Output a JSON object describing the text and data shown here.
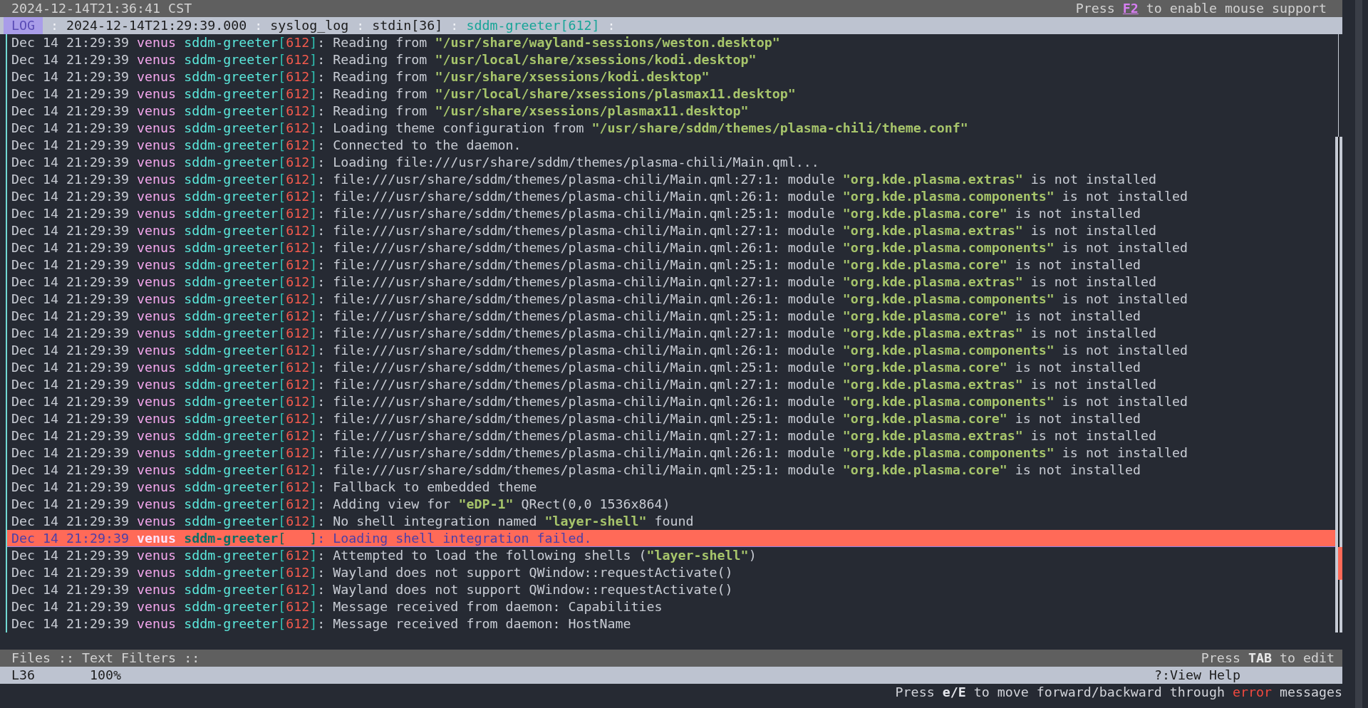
{
  "clock_bar": {
    "time": "2024-12-14T21:36:41 CST",
    "hint": [
      {
        "text": "Press "
      },
      {
        "text": "F2",
        "kind": "key"
      },
      {
        "text": " to enable mouse support"
      }
    ]
  },
  "breadcrumb_bar": {
    "view": "LOG",
    "crumbs": [
      {
        "separator": ":",
        "text": "2024-12-14T21:29:39.000",
        "selected": false
      },
      {
        "separator": ":",
        "text": "syslog_log",
        "selected": false
      },
      {
        "separator": ":",
        "text": "stdin[36]",
        "selected": false
      },
      {
        "separator": ":",
        "text": "sddm-greeter[612]",
        "selected": true
      }
    ],
    "trailing_separator": ":"
  },
  "log_lines": [
    {
      "time": "Dec 14 21:29:39",
      "host": "venus",
      "process": "sddm-greeter[612]:",
      "error": false,
      "message": "Reading from **\"/usr/share/wayland-sessions/weston.desktop\"**"
    },
    {
      "time": "Dec 14 21:29:39",
      "host": "venus",
      "process": "sddm-greeter[612]:",
      "error": false,
      "message": "Reading from **\"/usr/local/share/xsessions/kodi.desktop\"**"
    },
    {
      "time": "Dec 14 21:29:39",
      "host": "venus",
      "process": "sddm-greeter[612]:",
      "error": false,
      "message": "Reading from **\"/usr/share/xsessions/kodi.desktop\"**"
    },
    {
      "time": "Dec 14 21:29:39",
      "host": "venus",
      "process": "sddm-greeter[612]:",
      "error": false,
      "message": "Reading from **\"/usr/local/share/xsessions/plasmax11.desktop\"**"
    },
    {
      "time": "Dec 14 21:29:39",
      "host": "venus",
      "process": "sddm-greeter[612]:",
      "error": false,
      "message": "Reading from **\"/usr/share/xsessions/plasmax11.desktop\"**"
    },
    {
      "time": "Dec 14 21:29:39",
      "host": "venus",
      "process": "sddm-greeter[612]:",
      "error": false,
      "message": "Loading theme configuration from **\"/usr/share/sddm/themes/plasma-chili/theme.conf\"**"
    },
    {
      "time": "Dec 14 21:29:39",
      "host": "venus",
      "process": "sddm-greeter[612]:",
      "error": false,
      "message": "Connected to the daemon."
    },
    {
      "time": "Dec 14 21:29:39",
      "host": "venus",
      "process": "sddm-greeter[612]:",
      "error": false,
      "message": "Loading file:///usr/share/sddm/themes/plasma-chili/Main.qml..."
    },
    {
      "time": "Dec 14 21:29:39",
      "host": "venus",
      "process": "sddm-greeter[612]:",
      "error": false,
      "message": "file:///usr/share/sddm/themes/plasma-chili/Main.qml:27:1: module **\"org.kde.plasma.extras\"** is not installed"
    },
    {
      "time": "Dec 14 21:29:39",
      "host": "venus",
      "process": "sddm-greeter[612]:",
      "error": false,
      "message": "file:///usr/share/sddm/themes/plasma-chili/Main.qml:26:1: module **\"org.kde.plasma.components\"** is not installed"
    },
    {
      "time": "Dec 14 21:29:39",
      "host": "venus",
      "process": "sddm-greeter[612]:",
      "error": false,
      "message": "file:///usr/share/sddm/themes/plasma-chili/Main.qml:25:1: module **\"org.kde.plasma.core\"** is not installed"
    },
    {
      "time": "Dec 14 21:29:39",
      "host": "venus",
      "process": "sddm-greeter[612]:",
      "error": false,
      "message": "file:///usr/share/sddm/themes/plasma-chili/Main.qml:27:1: module **\"org.kde.plasma.extras\"** is not installed"
    },
    {
      "time": "Dec 14 21:29:39",
      "host": "venus",
      "process": "sddm-greeter[612]:",
      "error": false,
      "message": "file:///usr/share/sddm/themes/plasma-chili/Main.qml:26:1: module **\"org.kde.plasma.components\"** is not installed"
    },
    {
      "time": "Dec 14 21:29:39",
      "host": "venus",
      "process": "sddm-greeter[612]:",
      "error": false,
      "message": "file:///usr/share/sddm/themes/plasma-chili/Main.qml:25:1: module **\"org.kde.plasma.core\"** is not installed"
    },
    {
      "time": "Dec 14 21:29:39",
      "host": "venus",
      "process": "sddm-greeter[612]:",
      "error": false,
      "message": "file:///usr/share/sddm/themes/plasma-chili/Main.qml:27:1: module **\"org.kde.plasma.extras\"** is not installed"
    },
    {
      "time": "Dec 14 21:29:39",
      "host": "venus",
      "process": "sddm-greeter[612]:",
      "error": false,
      "message": "file:///usr/share/sddm/themes/plasma-chili/Main.qml:26:1: module **\"org.kde.plasma.components\"** is not installed"
    },
    {
      "time": "Dec 14 21:29:39",
      "host": "venus",
      "process": "sddm-greeter[612]:",
      "error": false,
      "message": "file:///usr/share/sddm/themes/plasma-chili/Main.qml:25:1: module **\"org.kde.plasma.core\"** is not installed"
    },
    {
      "time": "Dec 14 21:29:39",
      "host": "venus",
      "process": "sddm-greeter[612]:",
      "error": false,
      "message": "file:///usr/share/sddm/themes/plasma-chili/Main.qml:27:1: module **\"org.kde.plasma.extras\"** is not installed"
    },
    {
      "time": "Dec 14 21:29:39",
      "host": "venus",
      "process": "sddm-greeter[612]:",
      "error": false,
      "message": "file:///usr/share/sddm/themes/plasma-chili/Main.qml:26:1: module **\"org.kde.plasma.components\"** is not installed"
    },
    {
      "time": "Dec 14 21:29:39",
      "host": "venus",
      "process": "sddm-greeter[612]:",
      "error": false,
      "message": "file:///usr/share/sddm/themes/plasma-chili/Main.qml:25:1: module **\"org.kde.plasma.core\"** is not installed"
    },
    {
      "time": "Dec 14 21:29:39",
      "host": "venus",
      "process": "sddm-greeter[612]:",
      "error": false,
      "message": "file:///usr/share/sddm/themes/plasma-chili/Main.qml:27:1: module **\"org.kde.plasma.extras\"** is not installed"
    },
    {
      "time": "Dec 14 21:29:39",
      "host": "venus",
      "process": "sddm-greeter[612]:",
      "error": false,
      "message": "file:///usr/share/sddm/themes/plasma-chili/Main.qml:26:1: module **\"org.kde.plasma.components\"** is not installed"
    },
    {
      "time": "Dec 14 21:29:39",
      "host": "venus",
      "process": "sddm-greeter[612]:",
      "error": false,
      "message": "file:///usr/share/sddm/themes/plasma-chili/Main.qml:25:1: module **\"org.kde.plasma.core\"** is not installed"
    },
    {
      "time": "Dec 14 21:29:39",
      "host": "venus",
      "process": "sddm-greeter[612]:",
      "error": false,
      "message": "file:///usr/share/sddm/themes/plasma-chili/Main.qml:27:1: module **\"org.kde.plasma.extras\"** is not installed"
    },
    {
      "time": "Dec 14 21:29:39",
      "host": "venus",
      "process": "sddm-greeter[612]:",
      "error": false,
      "message": "file:///usr/share/sddm/themes/plasma-chili/Main.qml:26:1: module **\"org.kde.plasma.components\"** is not installed"
    },
    {
      "time": "Dec 14 21:29:39",
      "host": "venus",
      "process": "sddm-greeter[612]:",
      "error": false,
      "message": "file:///usr/share/sddm/themes/plasma-chili/Main.qml:25:1: module **\"org.kde.plasma.core\"** is not installed"
    },
    {
      "time": "Dec 14 21:29:39",
      "host": "venus",
      "process": "sddm-greeter[612]:",
      "error": false,
      "message": "Fallback to embedded theme"
    },
    {
      "time": "Dec 14 21:29:39",
      "host": "venus",
      "process": "sddm-greeter[612]:",
      "error": false,
      "message": "Adding view for **\"eDP-1\"** QRect(0,0 1536x864)"
    },
    {
      "time": "Dec 14 21:29:39",
      "host": "venus",
      "process": "sddm-greeter[612]:",
      "error": false,
      "message": "No shell integration named **\"layer-shell\"** found"
    },
    {
      "time": "Dec 14 21:29:39",
      "host": "venus",
      "process": "sddm-greeter[   ]:",
      "error": true,
      "message": "Loading shell integration failed."
    },
    {
      "time": "Dec 14 21:29:39",
      "host": "venus",
      "process": "sddm-greeter[612]:",
      "error": false,
      "message": "Attempted to load the following shells (**\"layer-shell\"**)"
    },
    {
      "time": "Dec 14 21:29:39",
      "host": "venus",
      "process": "sddm-greeter[612]:",
      "error": false,
      "message": "Wayland does not support QWindow::requestActivate()"
    },
    {
      "time": "Dec 14 21:29:39",
      "host": "venus",
      "process": "sddm-greeter[612]:",
      "error": false,
      "message": "Wayland does not support QWindow::requestActivate()"
    },
    {
      "time": "Dec 14 21:29:39",
      "host": "venus",
      "process": "sddm-greeter[612]:",
      "error": false,
      "message": "Message received from daemon: Capabilities"
    },
    {
      "time": "Dec 14 21:29:39",
      "host": "venus",
      "process": "sddm-greeter[612]:",
      "error": false,
      "message": "Message received from daemon: HostName"
    }
  ],
  "panel_bar": {
    "title": "Files :: Text Filters ::",
    "hint": [
      {
        "text": "Press "
      },
      {
        "text": "TAB",
        "kind": "key"
      },
      {
        "text": " to edit"
      }
    ]
  },
  "status_bar": {
    "line": "L36",
    "percent": "100%",
    "help": "?:View Help"
  },
  "help_line": [
    {
      "text": "Press "
    },
    {
      "text": "e/E",
      "kind": "key"
    },
    {
      "text": " to move forward/backward through "
    },
    {
      "text": "error",
      "kind": "error"
    },
    {
      "text": " messages"
    }
  ]
}
